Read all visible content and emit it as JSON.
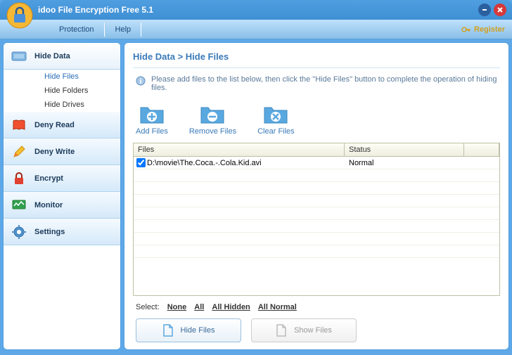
{
  "app": {
    "title": "idoo File Encryption Free 5.1"
  },
  "menu": {
    "protection": "Protection",
    "help": "Help",
    "register": "Register"
  },
  "sidebar": {
    "items": [
      {
        "label": "Hide Data"
      },
      {
        "label": "Deny Read"
      },
      {
        "label": "Deny Write"
      },
      {
        "label": "Encrypt"
      },
      {
        "label": "Monitor"
      },
      {
        "label": "Settings"
      }
    ],
    "sub": [
      {
        "label": "Hide Files"
      },
      {
        "label": "Hide Folders"
      },
      {
        "label": "Hide Drives"
      }
    ]
  },
  "content": {
    "breadcrumb": "Hide Data > Hide Files",
    "info": "Please add files to the list below, then click the \"Hide Files\" button to complete the operation of hiding files.",
    "tools": {
      "add": "Add Files",
      "remove": "Remove Files",
      "clear": "Clear Files"
    },
    "table": {
      "head_files": "Files",
      "head_status": "Status",
      "rows": [
        {
          "path": "D:\\movie\\The.Coca.-.Cola.Kid.avi",
          "status": "Normal",
          "checked": true
        }
      ]
    },
    "select": {
      "label": "Select:",
      "none": "None",
      "all": "All",
      "hidden": "All Hidden",
      "normal": "All Normal"
    },
    "actions": {
      "hide": "Hide Files",
      "show": "Show Files"
    }
  }
}
